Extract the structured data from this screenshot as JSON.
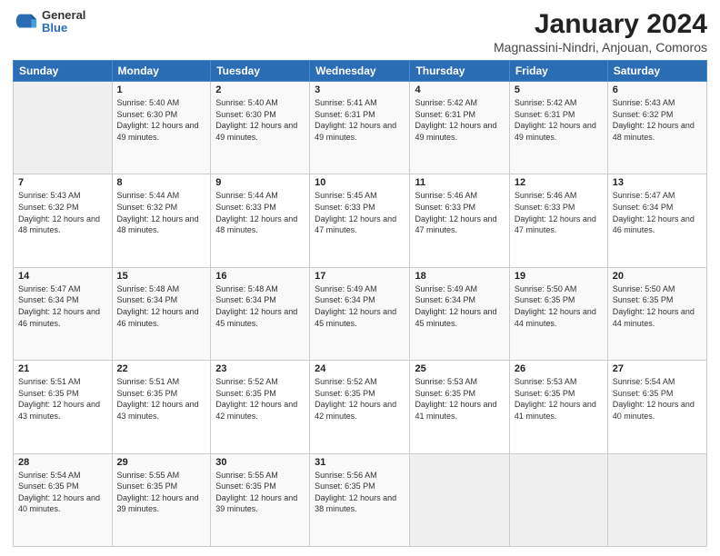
{
  "logo": {
    "general": "General",
    "blue": "Blue"
  },
  "header": {
    "title": "January 2024",
    "subtitle": "Magnassini-Nindri, Anjouan, Comoros"
  },
  "weekdays": [
    "Sunday",
    "Monday",
    "Tuesday",
    "Wednesday",
    "Thursday",
    "Friday",
    "Saturday"
  ],
  "weeks": [
    [
      {
        "day": "",
        "empty": true
      },
      {
        "day": "1",
        "sunrise": "5:40 AM",
        "sunset": "6:30 PM",
        "daylight": "12 hours and 49 minutes."
      },
      {
        "day": "2",
        "sunrise": "5:40 AM",
        "sunset": "6:30 PM",
        "daylight": "12 hours and 49 minutes."
      },
      {
        "day": "3",
        "sunrise": "5:41 AM",
        "sunset": "6:31 PM",
        "daylight": "12 hours and 49 minutes."
      },
      {
        "day": "4",
        "sunrise": "5:42 AM",
        "sunset": "6:31 PM",
        "daylight": "12 hours and 49 minutes."
      },
      {
        "day": "5",
        "sunrise": "5:42 AM",
        "sunset": "6:31 PM",
        "daylight": "12 hours and 49 minutes."
      },
      {
        "day": "6",
        "sunrise": "5:43 AM",
        "sunset": "6:32 PM",
        "daylight": "12 hours and 48 minutes."
      }
    ],
    [
      {
        "day": "7",
        "sunrise": "5:43 AM",
        "sunset": "6:32 PM",
        "daylight": "12 hours and 48 minutes."
      },
      {
        "day": "8",
        "sunrise": "5:44 AM",
        "sunset": "6:32 PM",
        "daylight": "12 hours and 48 minutes."
      },
      {
        "day": "9",
        "sunrise": "5:44 AM",
        "sunset": "6:33 PM",
        "daylight": "12 hours and 48 minutes."
      },
      {
        "day": "10",
        "sunrise": "5:45 AM",
        "sunset": "6:33 PM",
        "daylight": "12 hours and 47 minutes."
      },
      {
        "day": "11",
        "sunrise": "5:46 AM",
        "sunset": "6:33 PM",
        "daylight": "12 hours and 47 minutes."
      },
      {
        "day": "12",
        "sunrise": "5:46 AM",
        "sunset": "6:33 PM",
        "daylight": "12 hours and 47 minutes."
      },
      {
        "day": "13",
        "sunrise": "5:47 AM",
        "sunset": "6:34 PM",
        "daylight": "12 hours and 46 minutes."
      }
    ],
    [
      {
        "day": "14",
        "sunrise": "5:47 AM",
        "sunset": "6:34 PM",
        "daylight": "12 hours and 46 minutes."
      },
      {
        "day": "15",
        "sunrise": "5:48 AM",
        "sunset": "6:34 PM",
        "daylight": "12 hours and 46 minutes."
      },
      {
        "day": "16",
        "sunrise": "5:48 AM",
        "sunset": "6:34 PM",
        "daylight": "12 hours and 45 minutes."
      },
      {
        "day": "17",
        "sunrise": "5:49 AM",
        "sunset": "6:34 PM",
        "daylight": "12 hours and 45 minutes."
      },
      {
        "day": "18",
        "sunrise": "5:49 AM",
        "sunset": "6:34 PM",
        "daylight": "12 hours and 45 minutes."
      },
      {
        "day": "19",
        "sunrise": "5:50 AM",
        "sunset": "6:35 PM",
        "daylight": "12 hours and 44 minutes."
      },
      {
        "day": "20",
        "sunrise": "5:50 AM",
        "sunset": "6:35 PM",
        "daylight": "12 hours and 44 minutes."
      }
    ],
    [
      {
        "day": "21",
        "sunrise": "5:51 AM",
        "sunset": "6:35 PM",
        "daylight": "12 hours and 43 minutes."
      },
      {
        "day": "22",
        "sunrise": "5:51 AM",
        "sunset": "6:35 PM",
        "daylight": "12 hours and 43 minutes."
      },
      {
        "day": "23",
        "sunrise": "5:52 AM",
        "sunset": "6:35 PM",
        "daylight": "12 hours and 42 minutes."
      },
      {
        "day": "24",
        "sunrise": "5:52 AM",
        "sunset": "6:35 PM",
        "daylight": "12 hours and 42 minutes."
      },
      {
        "day": "25",
        "sunrise": "5:53 AM",
        "sunset": "6:35 PM",
        "daylight": "12 hours and 41 minutes."
      },
      {
        "day": "26",
        "sunrise": "5:53 AM",
        "sunset": "6:35 PM",
        "daylight": "12 hours and 41 minutes."
      },
      {
        "day": "27",
        "sunrise": "5:54 AM",
        "sunset": "6:35 PM",
        "daylight": "12 hours and 40 minutes."
      }
    ],
    [
      {
        "day": "28",
        "sunrise": "5:54 AM",
        "sunset": "6:35 PM",
        "daylight": "12 hours and 40 minutes."
      },
      {
        "day": "29",
        "sunrise": "5:55 AM",
        "sunset": "6:35 PM",
        "daylight": "12 hours and 39 minutes."
      },
      {
        "day": "30",
        "sunrise": "5:55 AM",
        "sunset": "6:35 PM",
        "daylight": "12 hours and 39 minutes."
      },
      {
        "day": "31",
        "sunrise": "5:56 AM",
        "sunset": "6:35 PM",
        "daylight": "12 hours and 38 minutes."
      },
      {
        "day": "",
        "empty": true
      },
      {
        "day": "",
        "empty": true
      },
      {
        "day": "",
        "empty": true
      }
    ]
  ]
}
